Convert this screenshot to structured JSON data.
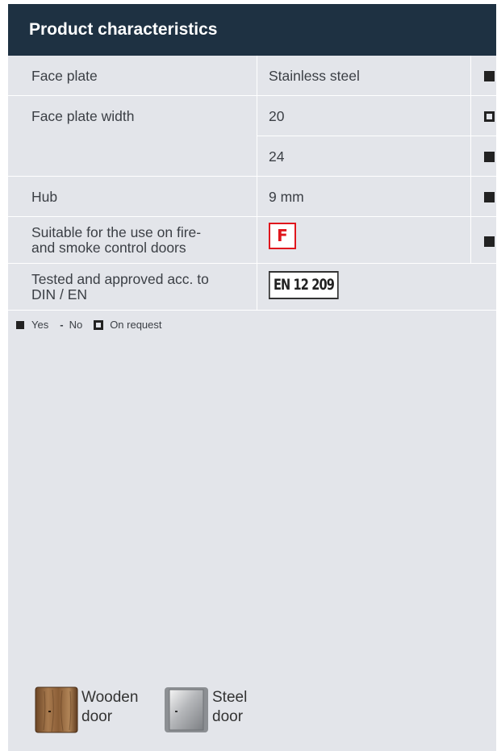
{
  "header": {
    "title": "Product characteristics"
  },
  "rows": {
    "face_plate": {
      "label": "Face plate",
      "value": "Stainless steel",
      "mark": "yes"
    },
    "face_plate_width": {
      "label": "Face plate width",
      "options": [
        {
          "value": "20",
          "mark": "on-request"
        },
        {
          "value": "24",
          "mark": "yes"
        }
      ]
    },
    "hub": {
      "label": "Hub",
      "value": "9 mm",
      "mark": "yes"
    },
    "fire_doors": {
      "label_line1": "Suitable for the use on fire-",
      "label_line2": "and smoke control doors",
      "badge": "F",
      "mark": "yes"
    },
    "tested": {
      "label_line1": "Tested and approved acc. to",
      "label_line2": "DIN / EN",
      "badge": "EN 12 209"
    }
  },
  "legend": {
    "yes": "Yes",
    "no_symbol": "-",
    "no": "No",
    "on_request": "On request"
  },
  "doors": {
    "wooden_line1": "Wooden",
    "wooden_line2": "door",
    "steel_line1": "Steel",
    "steel_line2": "door"
  },
  "colors": {
    "header_bg": "#1e3142",
    "card_bg": "#e3e5ea",
    "fire_red": "#e0161d"
  }
}
